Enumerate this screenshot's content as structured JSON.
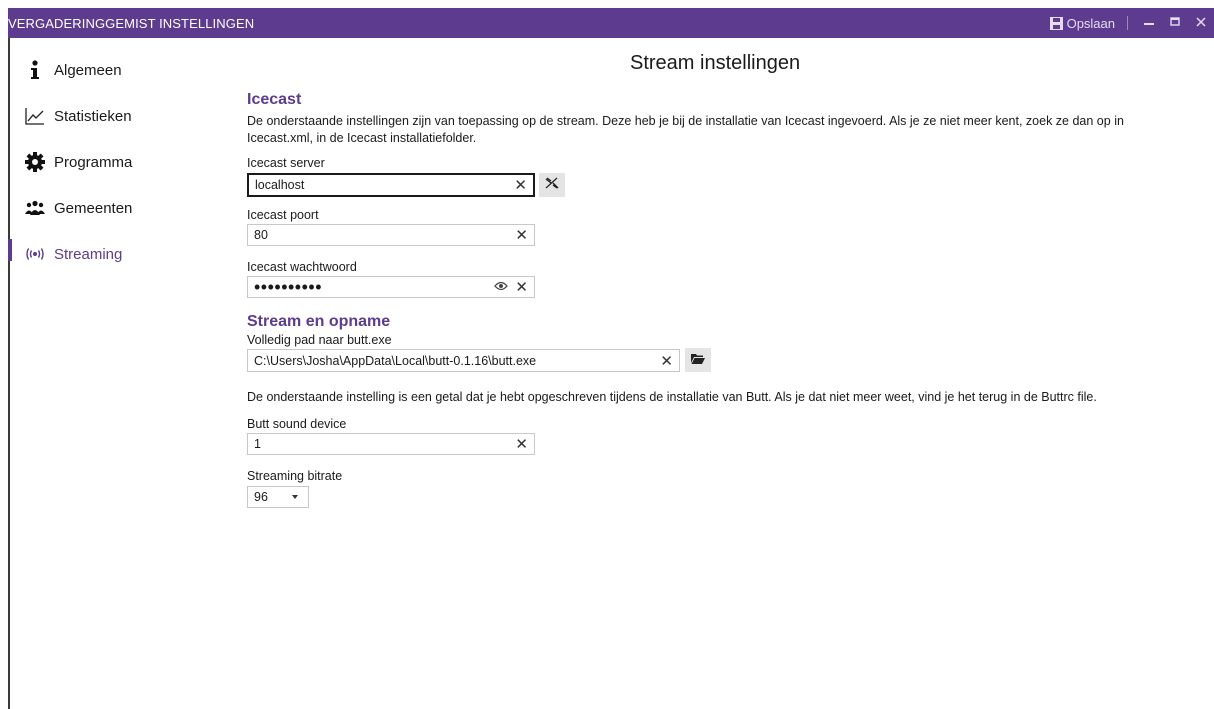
{
  "window": {
    "title": "VERGADERINGGEMIST INSTELLINGEN",
    "save_label": "Opslaan",
    "accent": "#5d3b8e"
  },
  "sidebar": {
    "items": [
      {
        "label": "Algemeen",
        "icon": "info-icon"
      },
      {
        "label": "Statistieken",
        "icon": "chart-line-icon"
      },
      {
        "label": "Programma",
        "icon": "gear-icon"
      },
      {
        "label": "Gemeenten",
        "icon": "group-icon"
      },
      {
        "label": "Streaming",
        "icon": "broadcast-icon",
        "active": true
      }
    ]
  },
  "main": {
    "page_title": "Stream instellingen",
    "icecast": {
      "title": "Icecast",
      "description_line1": "De onderstaande instellingen zijn van toepassing op de stream. Deze heb je bij de installatie van Icecast ingevoerd. Als je ze niet meer kent, zoek ze dan op in",
      "description_line2": "Icecast.xml, in de Icecast installatiefolder.",
      "server_label": "Icecast server",
      "server_value": "localhost",
      "port_label": "Icecast poort",
      "port_value": "80",
      "password_label": "Icecast wachtwoord",
      "password_value": "••••••••••"
    },
    "stream": {
      "title": "Stream en opname",
      "path_label": "Volledig pad naar butt.exe",
      "path_value": "C:\\Users\\Josha\\AppData\\Local\\butt-0.1.16\\butt.exe",
      "info_text": "De onderstaande instelling is een getal dat je hebt opgeschreven tijdens de installatie van Butt. Als je dat niet meer weet, vind je het terug in de Buttrc file.",
      "device_label": "Butt sound device",
      "device_value": "1",
      "bitrate_label": "Streaming bitrate",
      "bitrate_value": "96"
    }
  }
}
